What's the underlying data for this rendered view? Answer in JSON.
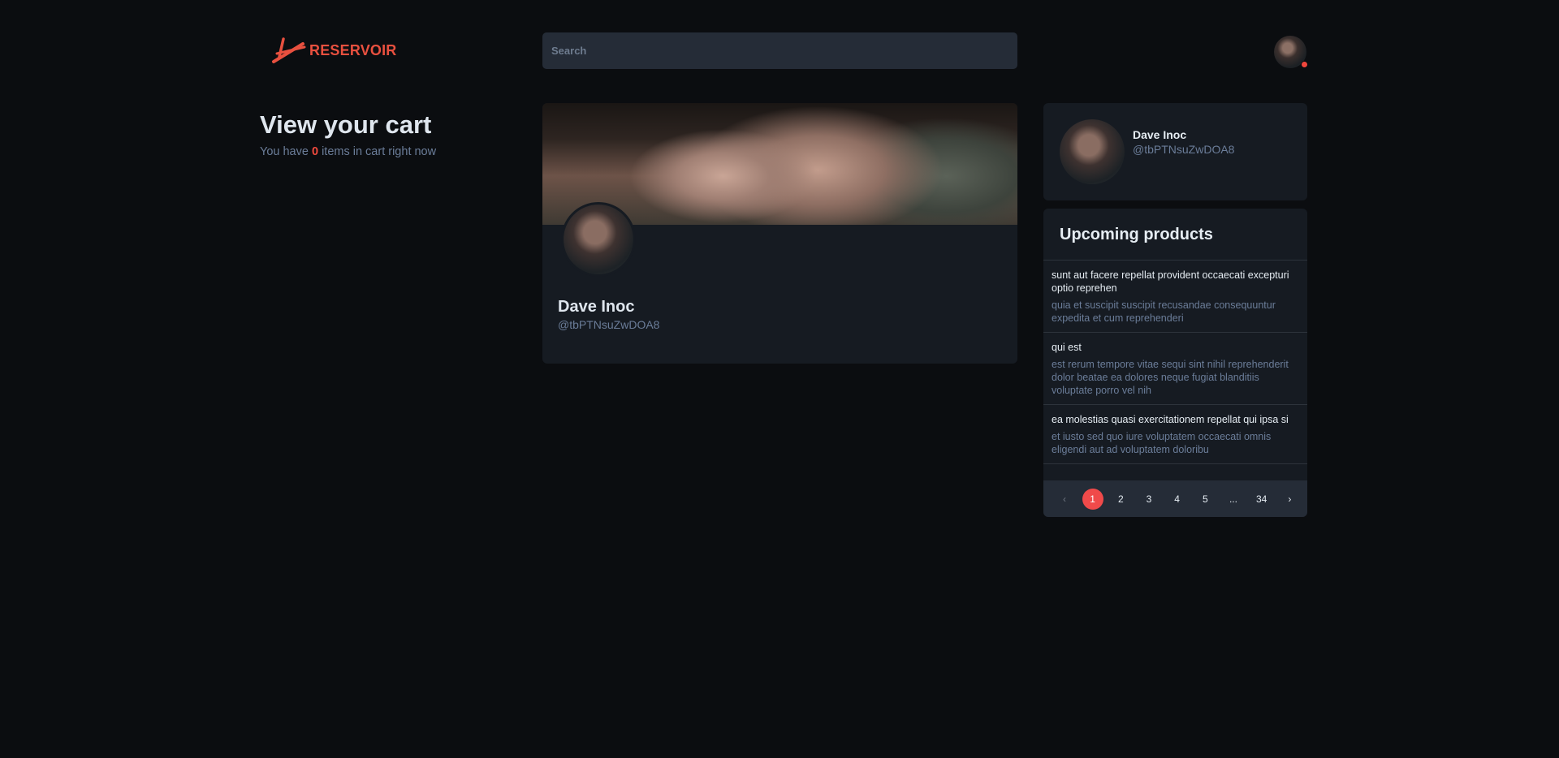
{
  "brand": {
    "name": "RESERVOIR",
    "accent": "#e8503f"
  },
  "search": {
    "placeholder": "Search",
    "value": ""
  },
  "cart": {
    "title": "View your cart",
    "prefix": "You have ",
    "count": "0",
    "suffix": " items in cart right now"
  },
  "profile": {
    "name": "Dave Inoc",
    "handle": "@tbPTNsuZwDOA8"
  },
  "sidebar_profile": {
    "name": "Dave Inoc",
    "handle": "@tbPTNsuZwDOA8"
  },
  "upcoming": {
    "title": "Upcoming products",
    "items": [
      {
        "title": "sunt aut facere repellat provident occaecati excepturi optio reprehen",
        "desc": "quia et suscipit suscipit recusandae consequuntur expedita et cum reprehenderi"
      },
      {
        "title": "qui est",
        "desc": "est rerum tempore vitae sequi sint nihil reprehenderit dolor beatae ea dolores neque fugiat blanditiis voluptate porro vel nih"
      },
      {
        "title": "ea molestias quasi exercitationem repellat qui ipsa si",
        "desc": "et iusto sed quo iure voluptatem occaecati omnis eligendi aut ad voluptatem doloribu"
      }
    ]
  },
  "pagination": {
    "prev": "‹",
    "pages": [
      "1",
      "2",
      "3",
      "4",
      "5",
      "...",
      "34"
    ],
    "active": "1",
    "next": "›"
  },
  "icons": {
    "logo": "reservoir-logo-icon",
    "status": "online-status-dot"
  }
}
